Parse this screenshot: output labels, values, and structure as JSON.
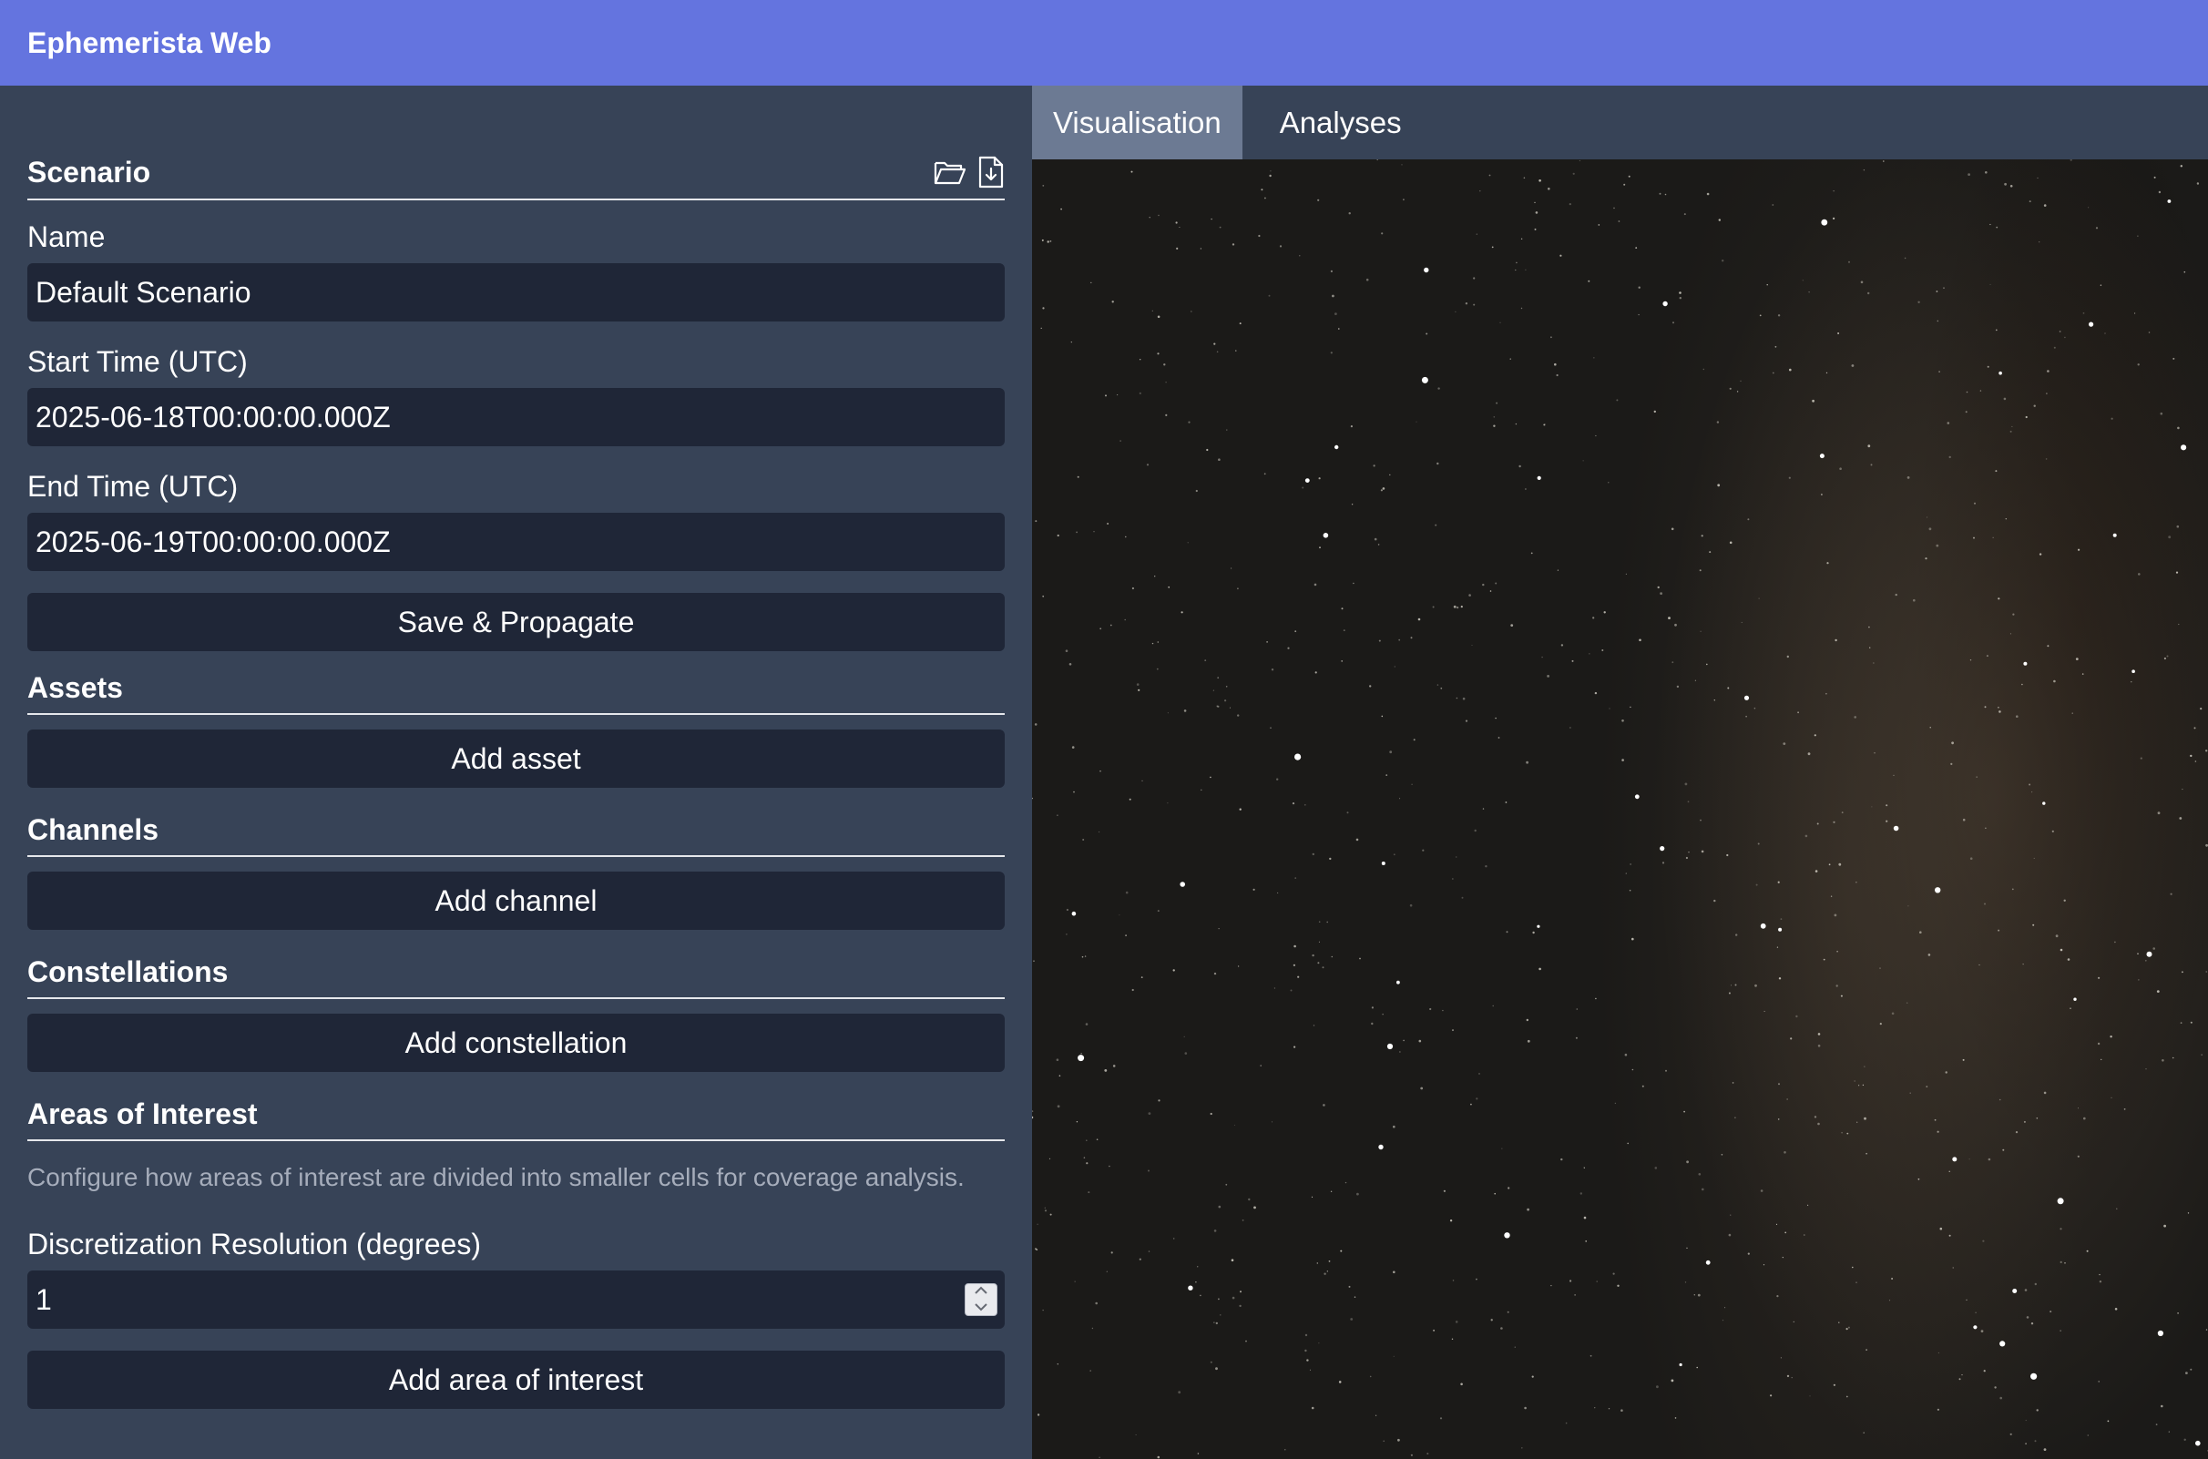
{
  "app": {
    "title": "Ephemerista Web"
  },
  "scenario": {
    "heading": "Scenario",
    "name_label": "Name",
    "name_value": "Default Scenario",
    "start_label": "Start Time (UTC)",
    "start_value": "2025-06-18T00:00:00.000Z",
    "end_label": "End Time (UTC)",
    "end_value": "2025-06-19T00:00:00.000Z",
    "save_label": "Save & Propagate",
    "icons": [
      "folder-open-icon",
      "file-download-icon"
    ]
  },
  "assets": {
    "heading": "Assets",
    "add_label": "Add asset"
  },
  "channels": {
    "heading": "Channels",
    "add_label": "Add channel"
  },
  "constellations": {
    "heading": "Constellations",
    "add_label": "Add constellation"
  },
  "aoi": {
    "heading": "Areas of Interest",
    "description": "Configure how areas of interest are divided into smaller cells for coverage analysis.",
    "resolution_label": "Discretization Resolution (degrees)",
    "resolution_value": "1",
    "add_label": "Add area of interest"
  },
  "tabs": [
    {
      "label": "Visualisation",
      "active": true
    },
    {
      "label": "Analyses",
      "active": false
    }
  ],
  "colors": {
    "topbar": "#6474df",
    "sidebar": "#374357",
    "input": "#1f2637",
    "active_tab": "#6c7a93"
  }
}
